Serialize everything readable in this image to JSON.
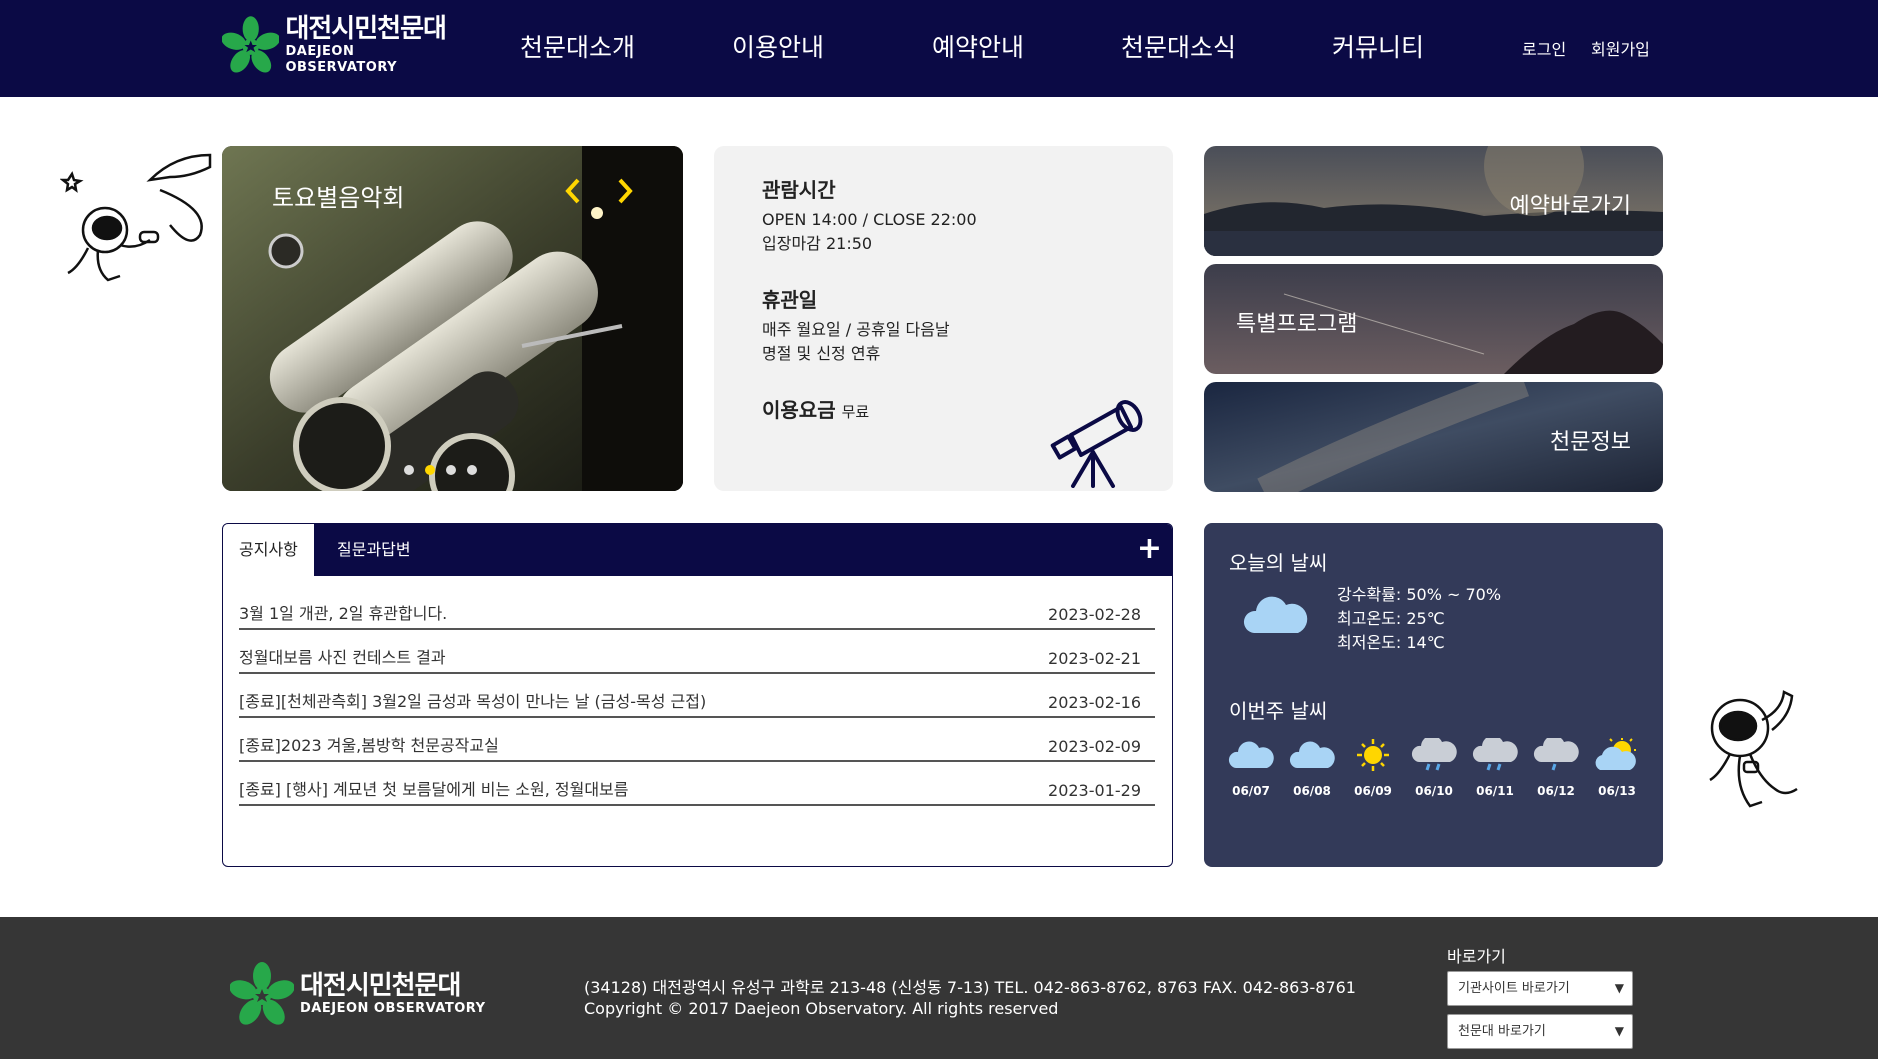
{
  "header": {
    "logo_kr": "대전시민천문대",
    "logo_en": "DAEJEON OBSERVATORY",
    "nav": [
      "천문대소개",
      "이용안내",
      "예약안내",
      "천문대소식",
      "커뮤니티"
    ],
    "login": "로그인",
    "signup": "회원가입"
  },
  "slider": {
    "title": "토요별음악회",
    "active_index": 1,
    "slide_count": 4
  },
  "info": {
    "hours_title": "관람시간",
    "hours_line1": "OPEN 14:00 / CLOSE 22:00",
    "hours_line2": "입장마감 21:50",
    "closed_title": "휴관일",
    "closed_line1": "매주 월요일 / 공휴일 다음날",
    "closed_line2": "명절 및 신정 연휴",
    "fee_title": "이용요금",
    "fee_value": "무료"
  },
  "cards": [
    "예약바로가기",
    "특별프로그램",
    "천문정보"
  ],
  "board": {
    "tabs": [
      "공지사항",
      "질문과답변"
    ],
    "more": "+",
    "notices": [
      {
        "title": "3월 1일 개관, 2일 휴관합니다.",
        "date": "2023-02-28"
      },
      {
        "title": "정월대보름 사진 컨테스트 결과",
        "date": "2023-02-21"
      },
      {
        "title": "[종료][천체관측회] 3월2일 금성과 목성이 만나는 날 (금성-목성 근접)",
        "date": "2023-02-16"
      },
      {
        "title": "[종료]2023 겨울,봄방학 천문공작교실",
        "date": "2023-02-09"
      },
      {
        "title": "[종료] [행사] 계묘년 첫 보름달에게 비는 소원, 정월대보름",
        "date": "2023-01-29"
      }
    ]
  },
  "weather": {
    "today_title": "오늘의 날씨",
    "rain_prob": "강수확률: 50% ~ 70%",
    "max_temp": "최고온도: 25℃",
    "min_temp": "최저온도: 14℃",
    "week_title": "이번주 날씨",
    "week": [
      {
        "date": "06/07",
        "icon": "cloud-icon"
      },
      {
        "date": "06/08",
        "icon": "cloud-icon"
      },
      {
        "date": "06/09",
        "icon": "sun-icon"
      },
      {
        "date": "06/10",
        "icon": "rain-icon"
      },
      {
        "date": "06/11",
        "icon": "rain-icon"
      },
      {
        "date": "06/12",
        "icon": "rain-icon"
      },
      {
        "date": "06/13",
        "icon": "partly-cloudy-icon"
      }
    ]
  },
  "footer": {
    "logo_kr": "대전시민천문대",
    "logo_en": "DAEJEON OBSERVATORY",
    "address": "(34128) 대전광역시 유성구 과학로 213-48 (신성동 7-13) TEL. 042-863-8762, 8763 FAX. 042-863-8761",
    "copyright": "Copyright © 2017 Daejeon Observatory. All rights reserved",
    "quick_title": "바로가기",
    "select1": "기관사이트 바로가기",
    "select2": "천문대 바로가기"
  },
  "colors": {
    "navy": "#0b0a45",
    "logo_green": "#27a84a",
    "weather_bg": "#333a59",
    "footer_bg": "#363636",
    "accent_yellow": "#ffd600"
  }
}
